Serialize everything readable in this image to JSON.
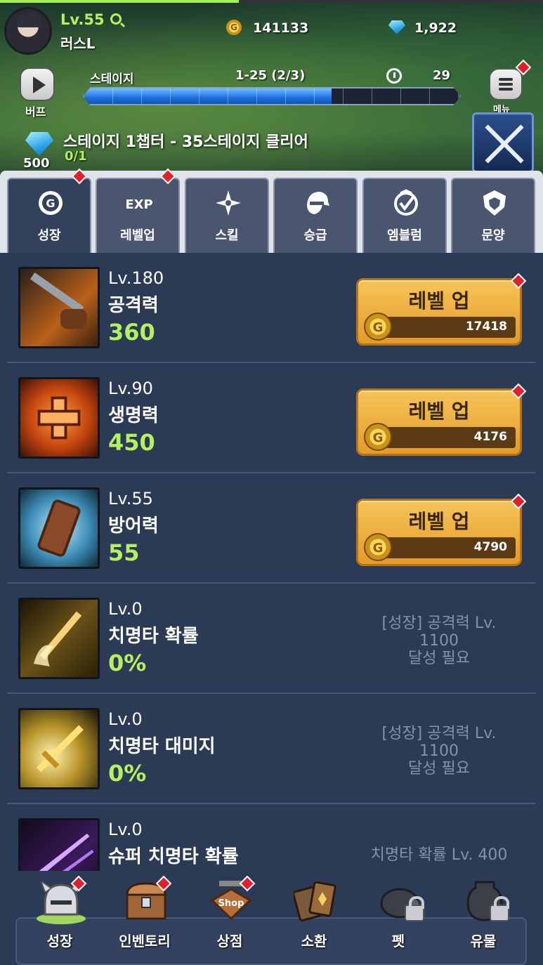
{
  "player": {
    "level": "Lv.55",
    "name": "러스L",
    "exp_fraction": 0.44
  },
  "currency": {
    "gold": "141133",
    "gems": "1,922"
  },
  "hud": {
    "buff_label": "버프",
    "stage_label": "스테이지",
    "stage_progress": "1-25  (2/3)",
    "timer": "29",
    "stage_fill_fraction": 0.66,
    "menu_label": "메뉴"
  },
  "quest": {
    "title": "스테이지 1챕터 - 35스테이지 클리어",
    "progress": "0/1",
    "reward": "500"
  },
  "tabs": [
    {
      "label": "성장",
      "icon": "gold-g-icon",
      "active": true
    },
    {
      "label": "레벨업",
      "icon": "exp-icon"
    },
    {
      "label": "스킬",
      "icon": "skill-shuriken-icon"
    },
    {
      "label": "승급",
      "icon": "ninja-head-icon"
    },
    {
      "label": "엠블럼",
      "icon": "emblem-badge-icon"
    },
    {
      "label": "문양",
      "icon": "shield-crest-icon"
    }
  ],
  "stats": [
    {
      "level": "Lv.180",
      "name": "공격력",
      "value": "360",
      "button": "레벨 업",
      "cost": "17418",
      "icon": "sword-icon"
    },
    {
      "level": "Lv.90",
      "name": "생명력",
      "value": "450",
      "button": "레벨 업",
      "cost": "4176",
      "icon": "health-cross-icon"
    },
    {
      "level": "Lv.55",
      "name": "방어력",
      "value": "55",
      "button": "레벨 업",
      "cost": "4790",
      "icon": "shield-icon"
    },
    {
      "level": "Lv.0",
      "name": "치명타 확률",
      "value": "0%",
      "requirement": "[성장] 공격력 Lv.\n1100\n달성 필요",
      "icon": "flaming-sword-icon"
    },
    {
      "level": "Lv.0",
      "name": "치명타 대미지",
      "value": "0%",
      "requirement": "[성장] 공격력 Lv.\n1100\n달성 필요",
      "icon": "golden-sword-icon"
    },
    {
      "level": "Lv.0",
      "name": "슈퍼 치명타 확률",
      "value": "",
      "requirement": "치명타 확률 Lv. 400",
      "icon": "purple-slash-icon"
    }
  ],
  "coin_letter": "G",
  "nav": [
    {
      "label": "성장",
      "icon": "helmet-icon",
      "locked": false,
      "active": true
    },
    {
      "label": "인벤토리",
      "icon": "chest-icon",
      "locked": false
    },
    {
      "label": "상점",
      "icon": "shop-sign-icon",
      "locked": false,
      "sign_text": "Shop"
    },
    {
      "label": "소환",
      "icon": "summon-cards-icon",
      "locked": false
    },
    {
      "label": "펫",
      "icon": "pet-pig-icon",
      "locked": true
    },
    {
      "label": "유물",
      "icon": "relic-jar-icon",
      "locked": true
    }
  ]
}
